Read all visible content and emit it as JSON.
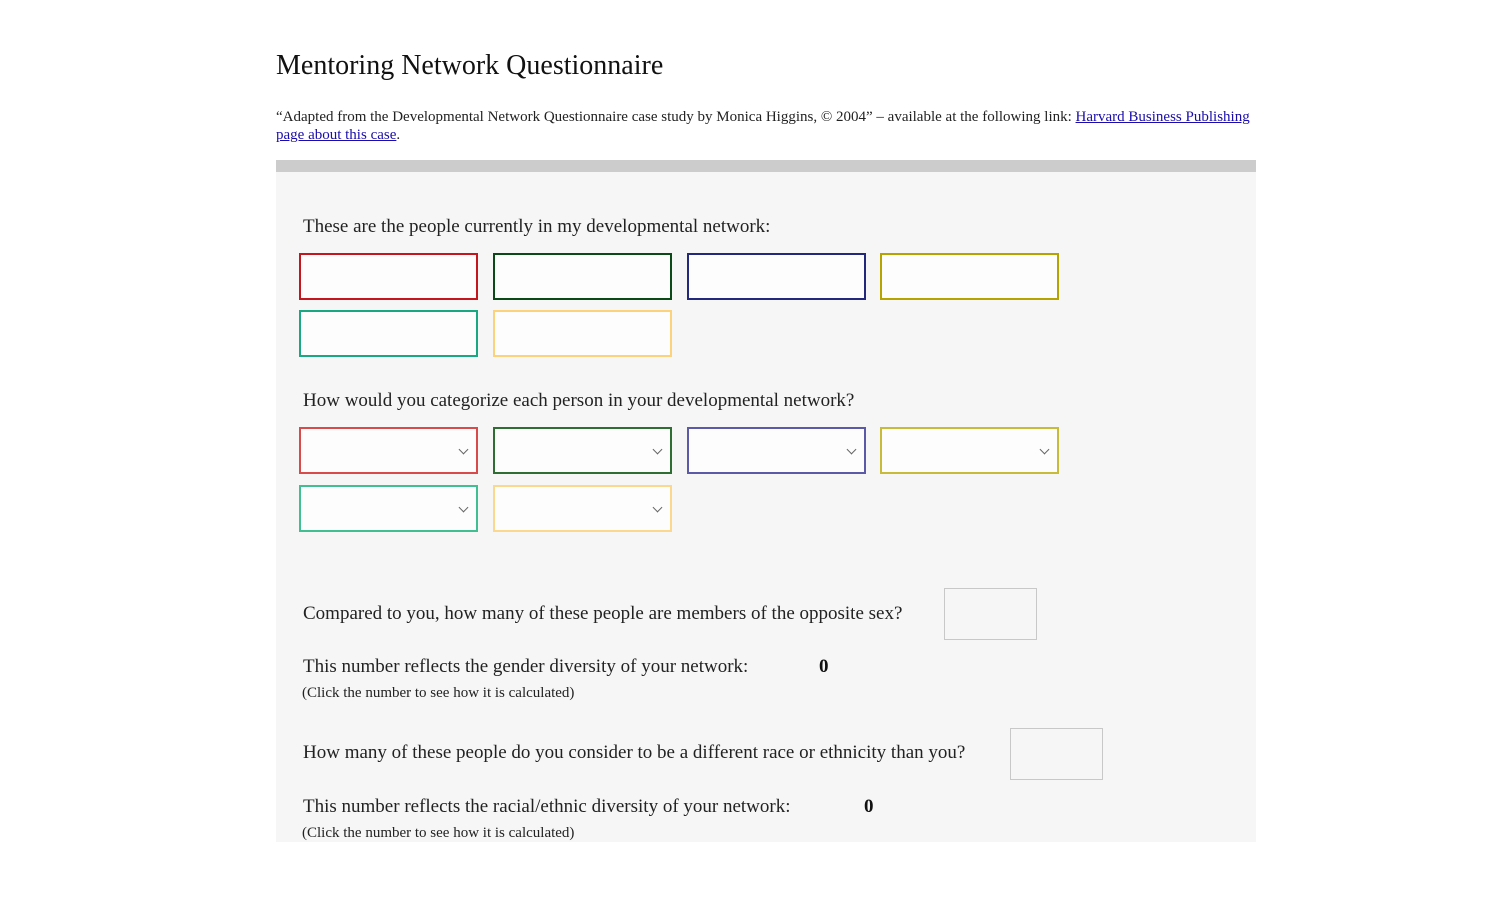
{
  "title": "Mentoring Network Questionnaire",
  "attribution": {
    "prefix": "“Adapted from the Developmental Network Questionnaire case study by Monica Higgins, © 2004” – available at the following link: ",
    "link_text": "Harvard Business Publishing page about this case",
    "suffix": "."
  },
  "people_section": {
    "label": "These are the people currently in my developmental network:",
    "fields": [
      {
        "value": "",
        "color": "#c4161c"
      },
      {
        "value": "",
        "color": "#0b4a16"
      },
      {
        "value": "",
        "color": "#23297a"
      },
      {
        "value": "",
        "color": "#b5a300"
      },
      {
        "value": "",
        "color": "#1aa882"
      },
      {
        "value": "",
        "color": "#fcd27a"
      }
    ]
  },
  "category_section": {
    "label": "How would you categorize each person in your developmental network?",
    "selects": [
      {
        "value": "",
        "color": "#d94a4a"
      },
      {
        "value": "",
        "color": "#2e6e33"
      },
      {
        "value": "",
        "color": "#5c5aa8"
      },
      {
        "value": "",
        "color": "#c8bb3a"
      },
      {
        "value": "",
        "color": "#3fbf92"
      },
      {
        "value": "",
        "color": "#fcd88f"
      }
    ]
  },
  "gender": {
    "question": "Compared to you, how many of these people are members of the opposite sex?",
    "input_value": "",
    "result_label": "This number reflects the gender diversity of your network:",
    "result_value": "0",
    "hint": "(Click the number to see how it is calculated)"
  },
  "race": {
    "question": "How many of these people do you consider to be a different race or ethnicity than you?",
    "input_value": "",
    "result_label": "This number reflects the racial/ethnic diversity of your network:",
    "result_value": "0",
    "hint": "(Click the number to see how it is calculated)"
  }
}
